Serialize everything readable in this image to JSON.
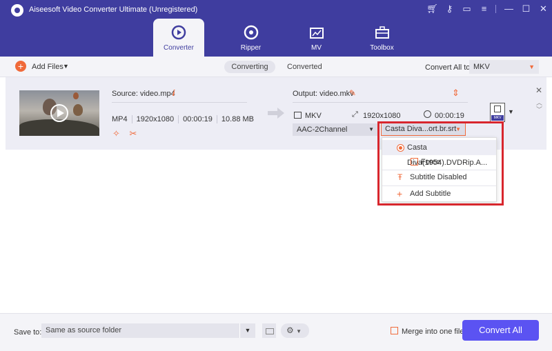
{
  "app": {
    "title": "Aiseesoft Video Converter Ultimate (Unregistered)"
  },
  "nav": {
    "tabs": [
      {
        "label": "Converter",
        "icon": "converter-icon",
        "active": true
      },
      {
        "label": "Ripper",
        "icon": "ripper-icon"
      },
      {
        "label": "MV",
        "icon": "mv-icon"
      },
      {
        "label": "Toolbox",
        "icon": "toolbox-icon"
      }
    ]
  },
  "toolbar": {
    "add_files": "Add Files",
    "converting": "Converting",
    "converted": "Converted",
    "convert_all_to": "Convert All to:",
    "format": "MKV"
  },
  "file": {
    "source": "Source: video.mp4",
    "format": "MP4",
    "resolution": "1920x1080",
    "duration": "00:00:19",
    "size": "10.88 MB",
    "output": "Output: video.mkv",
    "out_format": "MKV",
    "out_resolution": "1920x1080",
    "out_duration": "00:00:19",
    "audio": "AAC-2Channel",
    "subtitle": "Casta Diva...ort.br.srt",
    "badge": "MKV"
  },
  "dropdown": {
    "selected": "Casta Diva(1954).DVDRip.A...",
    "force": "Force",
    "disabled": "Subtitle Disabled",
    "add": "Add Subtitle"
  },
  "footer": {
    "save_to": "Save to:",
    "path": "Same as source folder",
    "merge": "Merge into one file",
    "convert_all": "Convert All"
  },
  "colors": {
    "accent": "#f06a3a",
    "brand": "#3f3d9f",
    "button": "#5b53f2",
    "highlight": "#d8262d"
  }
}
